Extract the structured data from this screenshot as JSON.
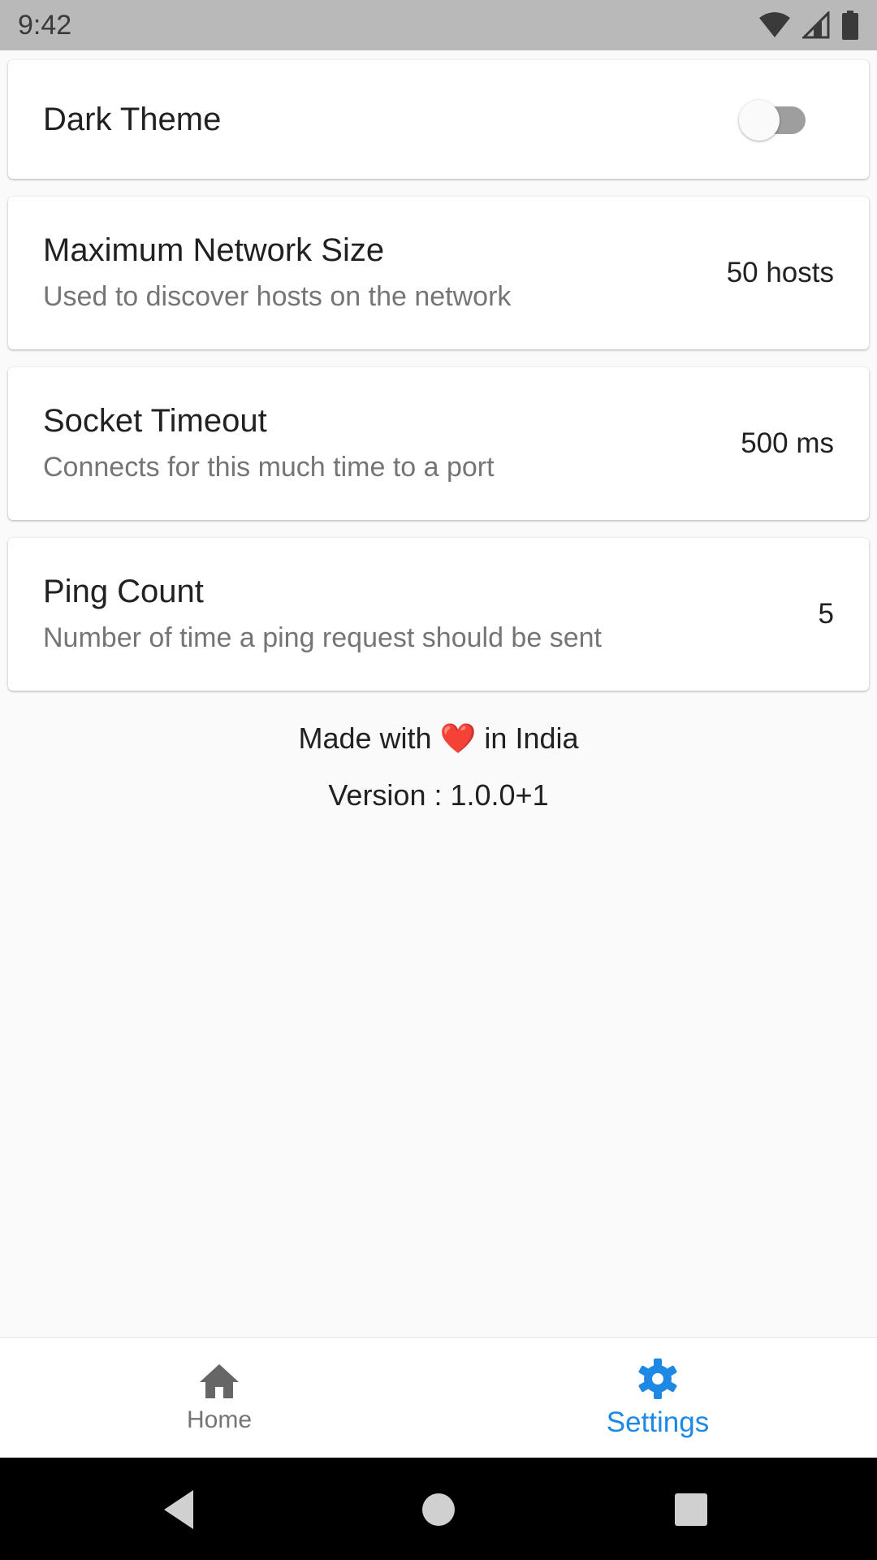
{
  "status_bar": {
    "time": "9:42"
  },
  "settings": {
    "dark_theme": {
      "title": "Dark Theme",
      "enabled": false
    },
    "network_size": {
      "title": "Maximum Network Size",
      "subtitle": "Used to discover hosts on the network",
      "value": "50 hosts"
    },
    "socket_timeout": {
      "title": "Socket Timeout",
      "subtitle": "Connects for this much time to a port",
      "value": "500 ms"
    },
    "ping_count": {
      "title": "Ping Count",
      "subtitle": "Number of time a ping request should be sent",
      "value": "5"
    }
  },
  "footer": {
    "made_prefix": "Made with",
    "heart": "❤️",
    "made_suffix": "in India",
    "version": "Version : 1.0.0+1"
  },
  "bottom_nav": {
    "items": [
      {
        "label": "Home",
        "icon": "home-icon",
        "active": false
      },
      {
        "label": "Settings",
        "icon": "gear-icon",
        "active": true
      }
    ],
    "active_color": "#1e88e5",
    "inactive_color": "#757575"
  }
}
